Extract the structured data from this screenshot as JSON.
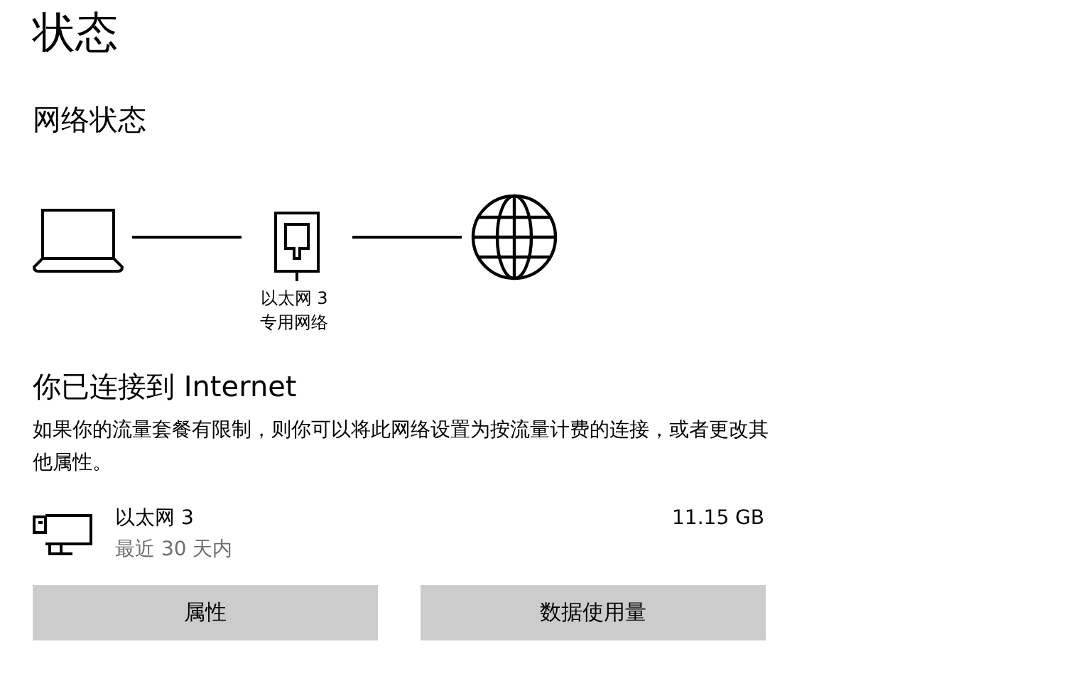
{
  "page_title": "状态",
  "network_status": {
    "heading": "网络状态",
    "adapter_label": "以太网 3",
    "network_type": "专用网络"
  },
  "connection": {
    "heading": "你已连接到 Internet",
    "description": "如果你的流量套餐有限制，则你可以将此网络设置为按流量计费的连接，或者更改其他属性。"
  },
  "usage": {
    "name": "以太网 3",
    "period": "最近 30 天内",
    "amount": "11.15 GB"
  },
  "buttons": [
    "属性",
    "数据使用量"
  ]
}
